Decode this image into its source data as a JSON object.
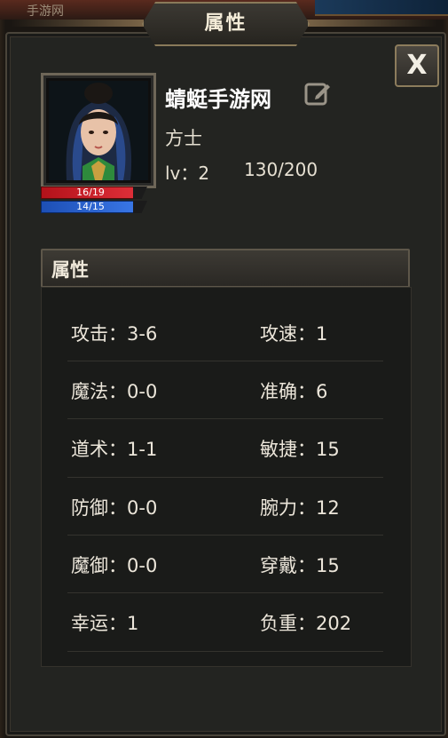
{
  "window": {
    "title": "属性",
    "close_label": "X",
    "bg_label": "手游网"
  },
  "character": {
    "name": "蜻蜓手游网",
    "job": "方士",
    "level_text": "lv：2",
    "exp_text": "130/200",
    "hp_text": "16/19",
    "mp_text": "14/15",
    "hp_fraction": 0.842,
    "mp_fraction": 0.933
  },
  "section": {
    "title": "属性"
  },
  "attributes": [
    {
      "left": "攻击：3-6",
      "right": "攻速：1"
    },
    {
      "left": "魔法：0-0",
      "right": "准确：6"
    },
    {
      "left": "道术：1-1",
      "right": "敏捷：15"
    },
    {
      "left": "防御：0-0",
      "right": "腕力：12"
    },
    {
      "left": "魔御：0-0",
      "right": "穿戴：15"
    },
    {
      "left": "幸运：1",
      "right": "负重：202"
    }
  ],
  "colors": {
    "hp": "#e0303a",
    "mp": "#3a78e8",
    "frame": "#8c7c5c"
  }
}
